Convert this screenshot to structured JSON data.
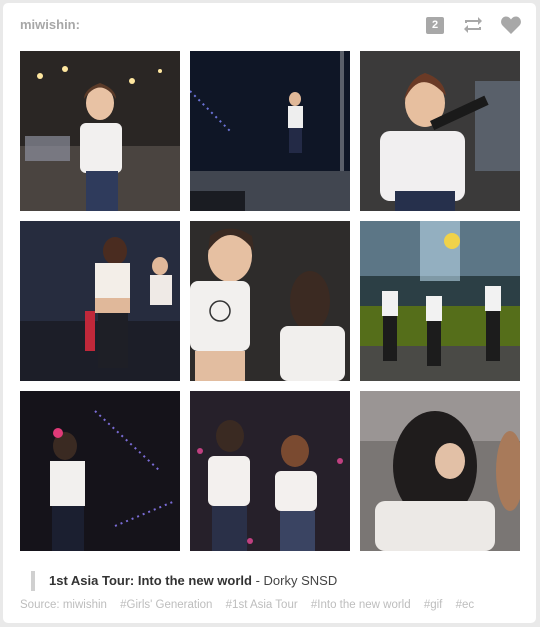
{
  "post": {
    "author": "miwishin:",
    "note_count": "2",
    "icons": {
      "reblog": "reblog-icon",
      "like": "heart-icon"
    },
    "caption_title": "1st Asia Tour: Into the new world",
    "caption_separator": " - ",
    "caption_rest": "Dorky SNSD",
    "source_label": "Source: miwishin",
    "tags": [
      "#Girls' Generation",
      "#1st Asia Tour",
      "#Into the new world",
      "#gif",
      "#ec"
    ]
  },
  "colors": {
    "author_gray": "#a7a7a7",
    "icon_gray": "#a8a8a8",
    "tag_gray": "#bdbdbd"
  }
}
